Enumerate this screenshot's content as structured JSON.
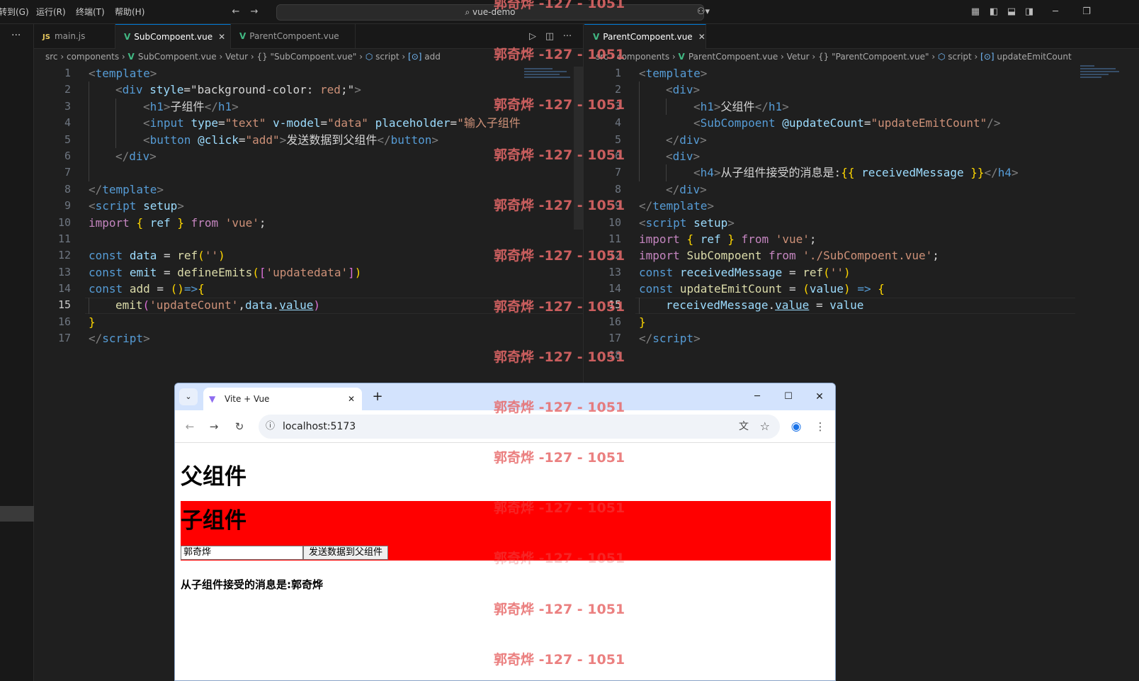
{
  "menu": {
    "goto": "转到(G)",
    "run": "运行(R)",
    "terminal": "终端(T)",
    "help": "帮助(H)"
  },
  "command_center": {
    "search_text": "vue-demo"
  },
  "left_group": {
    "tabs": [
      {
        "label": "main.js",
        "icon": "js-icon",
        "active": false
      },
      {
        "label": "SubCompoent.vue",
        "icon": "vue-icon",
        "active": true
      },
      {
        "label": "ParentCompoent.vue",
        "icon": "vue-icon",
        "active": false
      }
    ],
    "breadcrumb": [
      "src",
      "components",
      "SubCompoent.vue",
      "Vetur",
      "{} \"SubCompoent.vue\"",
      "script",
      "add"
    ]
  },
  "right_group": {
    "tabs": [
      {
        "label": "ParentCompoent.vue",
        "icon": "vue-icon",
        "active": true
      }
    ],
    "breadcrumb": [
      "src",
      "components",
      "ParentCompoent.vue",
      "Vetur",
      "{} \"ParentCompoent.vue\"",
      "script",
      "updateEmitCount"
    ]
  },
  "browser": {
    "tab_title": "Vite + Vue",
    "url": "localhost:5173",
    "page": {
      "parent_heading": "父组件",
      "child_heading": "子组件",
      "input_value": "郭奇烨",
      "send_button": "发送数据到父组件",
      "received_label": "从子组件接受的消息是:郭奇烨"
    }
  },
  "watermark_text": "郭奇烨 -127 - 1051",
  "colors": {
    "accent": "#0078d4",
    "vue": "#41b883",
    "child_bg": "#ff0000"
  }
}
